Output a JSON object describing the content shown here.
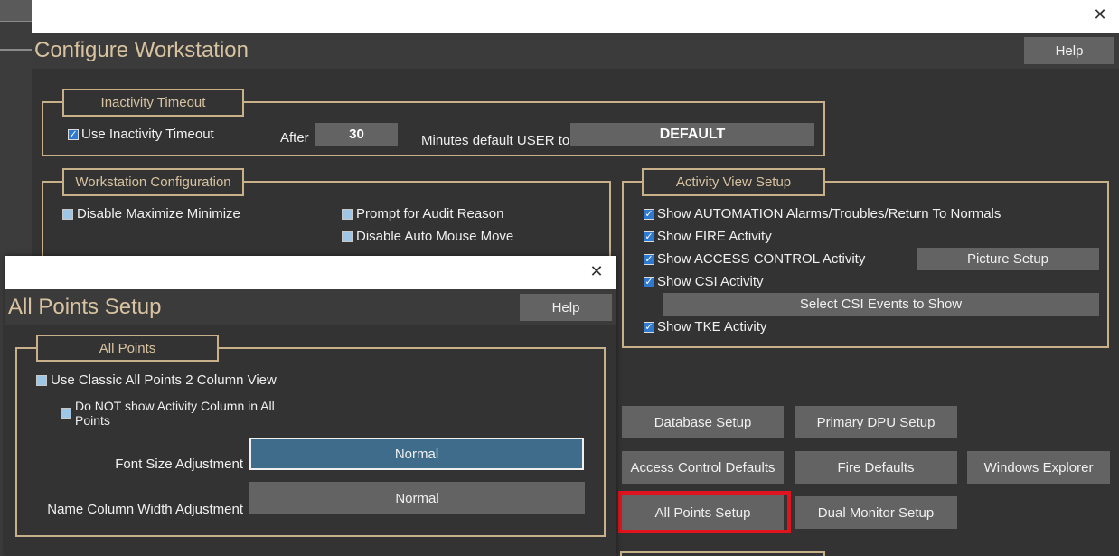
{
  "background_window": {
    "title": "Configure Workstation",
    "help_label": "Help",
    "inactivity": {
      "legend": "Inactivity Timeout",
      "use_label": "Use Inactivity Timeout",
      "use_checked": true,
      "after_label": "After",
      "minutes_value": "30",
      "minutes_label": "Minutes default USER to:",
      "user_value": "DEFAULT"
    },
    "workstation_config": {
      "legend": "Workstation Configuration",
      "items": [
        {
          "label": "Disable Maximize Minimize",
          "checked": false
        },
        {
          "label": "Prompt for Audit Reason",
          "checked": false
        },
        {
          "label": "Disable Auto Mouse Move",
          "checked": false
        }
      ]
    },
    "activity_view": {
      "legend": "Activity View Setup",
      "items": [
        {
          "label": "Show AUTOMATION Alarms/Troubles/Return To Normals",
          "checked": true
        },
        {
          "label": "Show FIRE Activity",
          "checked": true
        },
        {
          "label": "Show ACCESS CONTROL Activity",
          "checked": true
        },
        {
          "label": "Show CSI Activity",
          "checked": true
        },
        {
          "label": "Show TKE Activity",
          "checked": true
        }
      ],
      "picture_setup_label": "Picture Setup",
      "select_csi_label": "Select CSI Events to Show"
    },
    "buttons": {
      "database_setup": "Database Setup",
      "primary_dpu_setup": "Primary DPU Setup",
      "access_control_defaults": "Access Control Defaults",
      "fire_defaults": "Fire Defaults",
      "windows_explorer": "Windows Explorer",
      "all_points_setup": "All Points Setup",
      "dual_monitor_setup": "Dual Monitor Setup"
    },
    "colors": {
      "highlight": "#e0141e"
    }
  },
  "dialog": {
    "title": "All Points Setup",
    "help_label": "Help",
    "group_legend": "All Points",
    "classic_view_label": "Use Classic All Points 2 Column View",
    "classic_view_checked": false,
    "no_activity_label": "Do NOT show Activity Column in All Points",
    "no_activity_checked": false,
    "font_size_label": "Font Size Adjustment",
    "font_size_value": "Normal",
    "name_width_label": "Name Column Width Adjustment",
    "name_width_value": "Normal",
    "colors": {
      "selected_field": "#3e6c8a"
    }
  }
}
